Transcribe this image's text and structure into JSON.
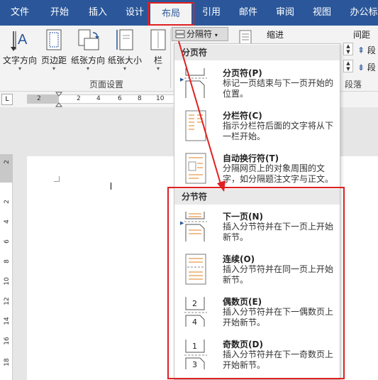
{
  "tabs": [
    "文件",
    "开始",
    "插入",
    "设计",
    "布局",
    "引用",
    "邮件",
    "审阅",
    "视图",
    "办公标"
  ],
  "active_tab": "布局",
  "ribbon": {
    "text_direction": "文字方向",
    "margins": "页边距",
    "orientation": "纸张方向",
    "size": "纸张大小",
    "columns": "栏",
    "breaks": "分隔符",
    "indent": "缩进",
    "spacing": "间距",
    "para_abbr_1": "段",
    "para_abbr_2": "段",
    "page_setup_group": "页面设置",
    "paragraph_group": "段落"
  },
  "ruler": {
    "tab_selector": "L",
    "numbers": [
      "2",
      "2",
      "4",
      "6",
      "8",
      "10"
    ],
    "vertical_numbers": [
      "2",
      "2",
      "4",
      "6",
      "8",
      "10",
      "12",
      "14",
      "16",
      "18"
    ]
  },
  "menu": {
    "page_breaks_header": "分页符",
    "section_breaks_header": "分节符",
    "items": [
      {
        "title": "分页符(P)",
        "desc": "标记一页结束与下一页开始的位置。"
      },
      {
        "title": "分栏符(C)",
        "desc": "指示分栏符后面的文字将从下一栏开始。"
      },
      {
        "title": "自动换行符(T)",
        "desc": "分隔网页上的对象周围的文字，如分隔题注文字与正文。"
      },
      {
        "title": "下一页(N)",
        "desc": "插入分节符并在下一页上开始新节。"
      },
      {
        "title": "连续(O)",
        "desc": "插入分节符并在同一页上开始新节。"
      },
      {
        "title": "偶数页(E)",
        "desc": "插入分节符并在下一偶数页上开始新节。"
      },
      {
        "title": "奇数页(D)",
        "desc": "插入分节符并在下一奇数页上开始新节。"
      }
    ],
    "even_icon_digits": [
      "2",
      "4"
    ],
    "odd_icon_digits": [
      "1",
      "3"
    ]
  },
  "colors": {
    "ribbon_blue": "#2b579a",
    "highlight_red": "#e02020"
  }
}
